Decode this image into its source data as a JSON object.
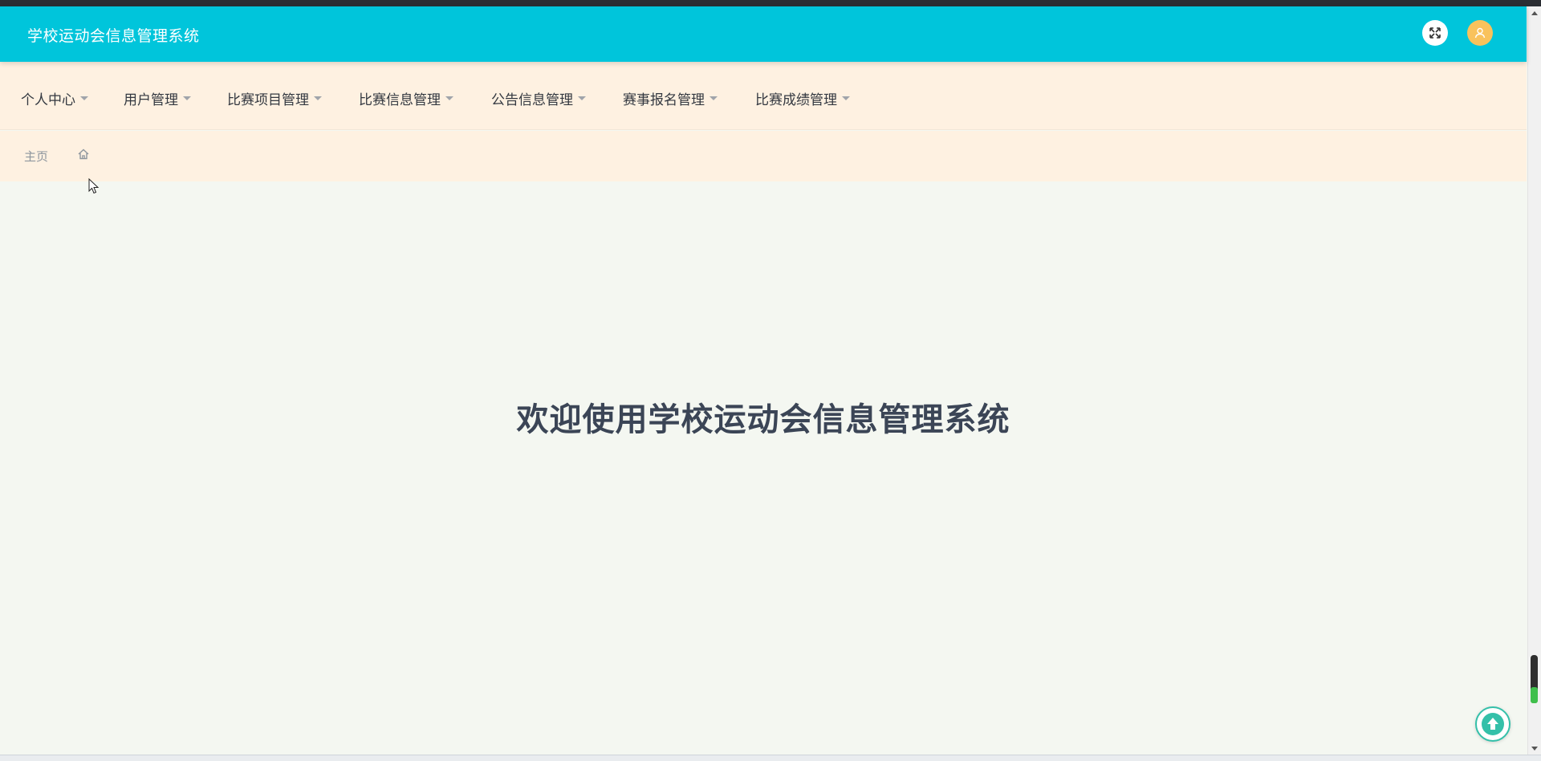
{
  "app": {
    "title": "学校运动会信息管理系统"
  },
  "header": {
    "fullscreen_icon": "expand-icon",
    "avatar_icon": "user-icon",
    "colors": {
      "header_bg": "#00c5db",
      "nav_bg": "#fef1e1",
      "avatar_bg": "#f9c25c"
    }
  },
  "nav": {
    "items": [
      {
        "label": "个人中心"
      },
      {
        "label": "用户管理"
      },
      {
        "label": "比赛项目管理"
      },
      {
        "label": "比赛信息管理"
      },
      {
        "label": "公告信息管理"
      },
      {
        "label": "赛事报名管理"
      },
      {
        "label": "比赛成绩管理"
      }
    ]
  },
  "breadcrumb": {
    "home_label": "主页",
    "home_icon": "home-icon"
  },
  "main": {
    "welcome_text": "欢迎使用学校运动会信息管理系统"
  },
  "widgets": {
    "back_to_top_icon": "arrow-up-circle-icon"
  }
}
